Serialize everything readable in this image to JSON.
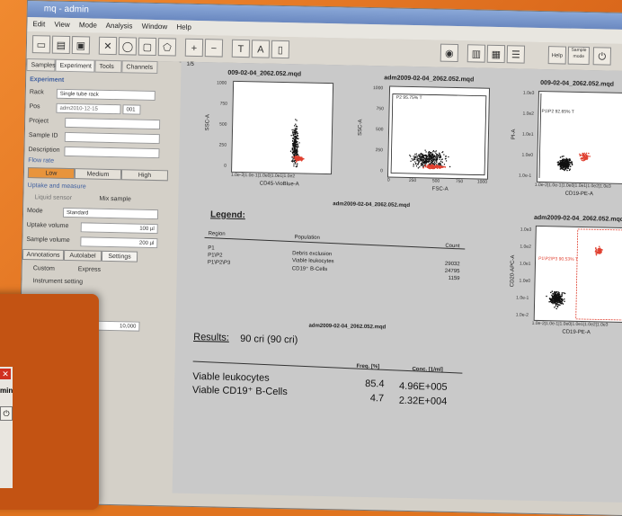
{
  "window": {
    "title": "mq - admin",
    "menu": [
      "Edit",
      "View",
      "Mode",
      "Analysis",
      "Window",
      "Help"
    ]
  },
  "toolbar_icons": [
    "new-icon",
    "open-icon",
    "save-icon",
    "cut-icon",
    "ellipse-icon",
    "rectangle-icon",
    "polygon-icon",
    "plus-icon",
    "minus-icon",
    "text-icon",
    "font-icon",
    "page-icon",
    "gate-icon",
    "lock-icon",
    "grid-icon",
    "list-icon",
    "help-icon",
    "sample-icon",
    "exit-icon"
  ],
  "toolbar_labels": {
    "help": "Help",
    "sample": "Sample mode"
  },
  "left_panel": {
    "tabs": [
      "Samples",
      "Experiment",
      "Tools",
      "Channels"
    ],
    "section": "Experiment",
    "rack_value": "Single tube rack",
    "sample_name": "adm2010-12-15",
    "sample_num": "001",
    "labels": [
      "Rack",
      "Pos",
      "Project",
      "Sample ID",
      "Description",
      "Flow rate"
    ],
    "flow_rates": [
      "Low",
      "Medium",
      "High"
    ],
    "uptake_section": "Uptake and measure",
    "liquid_sensor": "Liquid sensor",
    "mix_sample": "Mix sample",
    "mode_value": "Standard",
    "mode_label": "Mode",
    "uptake_label": "Uptake volume",
    "uptake_value": "100 µl",
    "sample_label": "Sample volume",
    "sample_value": "200 µl",
    "lower_tabs": [
      "Annotations",
      "Autolabel",
      "Settings"
    ],
    "radios": [
      "Custom",
      "Express"
    ],
    "instrument_setting": "Instrument setting",
    "count_value": "10,000"
  },
  "report": {
    "page": "1/5",
    "plot1": {
      "title": "009-02-04_2062.052.mqd",
      "xlabel": "CD45-VioBlue-A",
      "ylabel": "SSC-A",
      "yticks": [
        "1000",
        "750",
        "500",
        "250",
        "0"
      ],
      "xticks": "1.0e-2|1.0e-1|1.0e0|1.0e1|1.0e2"
    },
    "plot2": {
      "title": "adm2009-02-04_2062.052.mqd",
      "xlabel": "FSC-A",
      "ylabel": "SSC-A",
      "yticks": [
        "1000",
        "750",
        "500",
        "250",
        "0"
      ],
      "xticks": [
        "0",
        "250",
        "500",
        "750",
        "1000"
      ],
      "gate": "P2\n95.75% T"
    },
    "plot3": {
      "title": "009-02-04_2062.052.mqd",
      "xlabel": "CD19-PE-A",
      "ylabel": "PI-A",
      "yticks": [
        "1.0e3",
        "1.0e2",
        "1.0e1",
        "1.0e0",
        "1.0e-1"
      ],
      "xticks": "1.0e-2|1.0e-1|1.0e0|1.0e1|1.0e2|1.0e3",
      "gate": "P1\\P2\n92.65% T"
    },
    "plot4": {
      "title": "adm2009-02-04_2062.052.mqd",
      "xlabel": "CD19-PE-A",
      "ylabel": "CD20-APC-A",
      "yticks": [
        "1.0e3",
        "1.0e2",
        "1.0e1",
        "1.0e0",
        "1.0e-1",
        "1.0e-2"
      ],
      "xticks": "1.0e-2|1.0e-1|1.0e0|1.0e1|1.0e2|1.0e3",
      "gate": "P1\\P2\\P3\n90.53% T"
    },
    "subtitle": "adm2009-02-04_2062.052.mqd",
    "legend_heading": "Legend:",
    "legend_cols": [
      "Region",
      "Population",
      "Count"
    ],
    "legend_rows": [
      {
        "region": "P1",
        "population": "Debris exclusion",
        "count": "29032"
      },
      {
        "region": "P1\\P2",
        "population": "Viable leukocytes",
        "count": "24795"
      },
      {
        "region": "P1\\P2\\P3",
        "population": "CD19⁺ B-Cells",
        "count": "1159"
      }
    ],
    "results_file": "adm2009-02-04_2062.052.mqd",
    "results_heading": "Results:",
    "results_value": "90 cri (90 cri)",
    "results_cols": [
      "Freq. [%]",
      "Conc. [1/ml]"
    ],
    "results_rows": [
      {
        "label": "Viable leukocytes",
        "freq": "85.4",
        "conc": "4.96E+005"
      },
      {
        "label": "Viable CD19⁺ B-Cells",
        "freq": "4.7",
        "conc": "2.32E+004"
      }
    ]
  },
  "corner_window": {
    "label": "min"
  },
  "colors": {
    "background": "#e0741f",
    "events": "#111111",
    "gated": "#e04030"
  }
}
